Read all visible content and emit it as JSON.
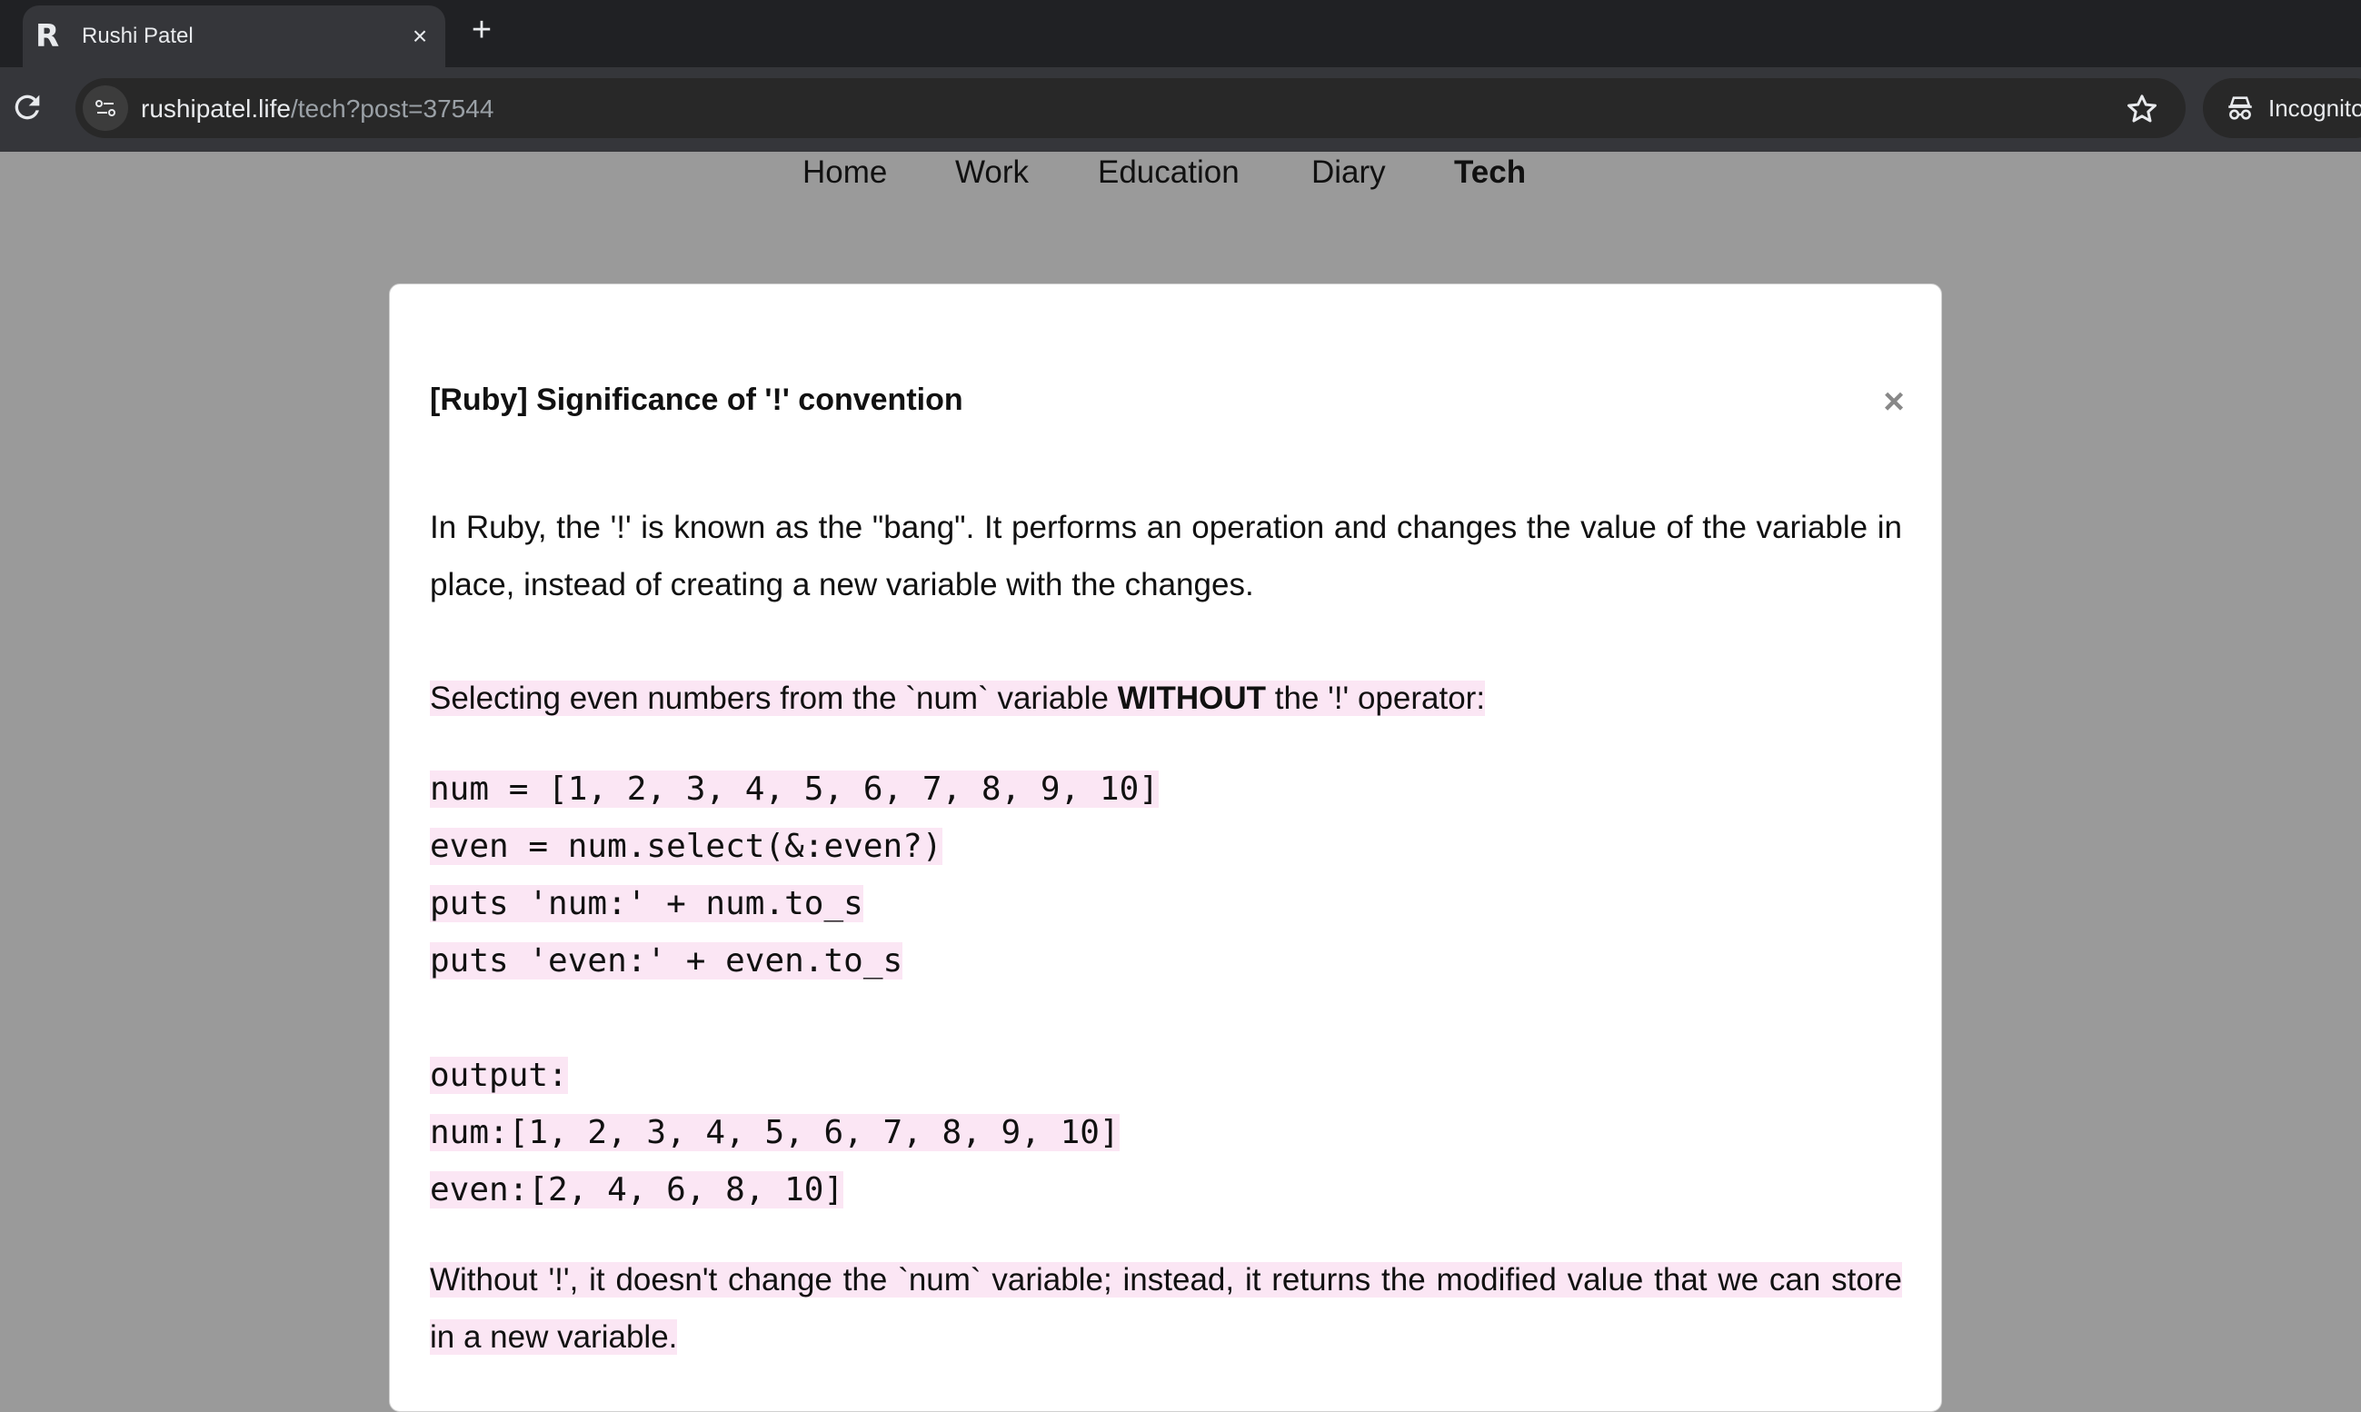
{
  "browser": {
    "tab_title": "Rushi Patel",
    "tab_favicon": "R",
    "url_host": "rushipatel.life",
    "url_path": "/tech?post=37544",
    "incognito_label": "Incognito",
    "icons": [
      "reload-icon",
      "site-info-icon",
      "bookmark-star-icon",
      "incognito-icon",
      "close-icon",
      "plus-icon"
    ]
  },
  "nav": {
    "items": [
      "Home",
      "Work",
      "Education",
      "Diary",
      "Tech"
    ],
    "active": "Tech"
  },
  "post": {
    "title": "[Ruby] Significance of '!' convention",
    "close_glyph": "×",
    "intro": "In Ruby, the '!' is known as the \"bang\". It performs an operation and changes the value of the variable in place, instead of creating a new variable with the changes.",
    "heading_pre": "Selecting even numbers from the `num` variable ",
    "heading_bold": "WITHOUT",
    "heading_post": " the '!' operator:",
    "code": [
      "num = [1, 2, 3, 4, 5, 6, 7, 8, 9, 10]",
      "even = num.select(&:even?)",
      "puts 'num:' + num.to_s",
      "puts 'even:' + even.to_s"
    ],
    "output": [
      "output:",
      "num:[1, 2, 3, 4, 5, 6, 7, 8, 9, 10]",
      "even:[2, 4, 6, 8, 10]"
    ],
    "conclusion": "Without '!', it doesn't change the `num` variable; instead, it returns the modified value that we can store in a new variable."
  },
  "colors": {
    "highlight": "#fbe6f4",
    "backdrop": "#9a9a9a"
  }
}
